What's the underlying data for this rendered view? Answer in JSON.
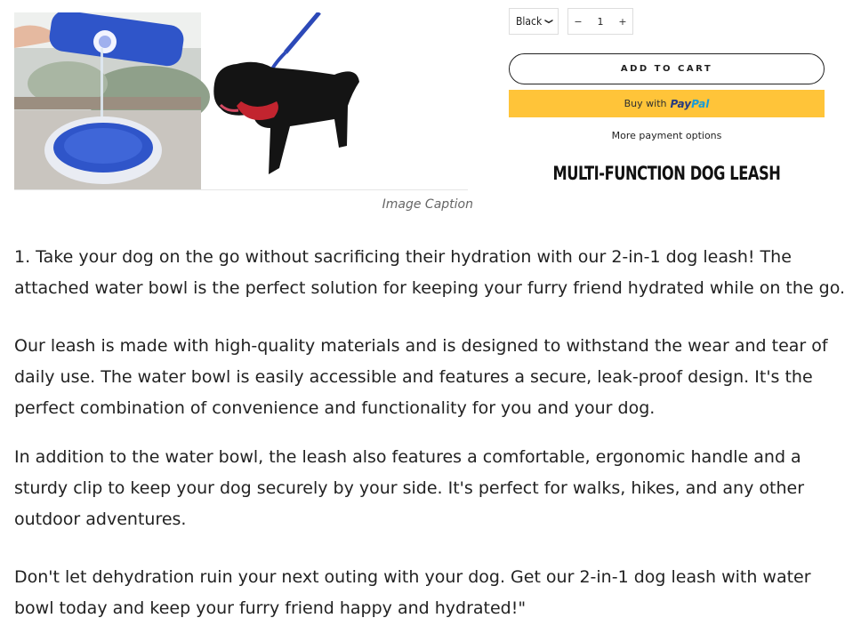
{
  "image": {
    "caption": "Image Caption"
  },
  "product": {
    "variant_selected": "Black",
    "quantity": "1",
    "decrement_label": "−",
    "increment_label": "+",
    "add_to_cart_label": "ADD TO CART",
    "paypal_prefix": "Buy with",
    "paypal_logo_pay": "Pay",
    "paypal_logo_pal": "Pal",
    "more_payment_label": "More payment options",
    "title": "MULTI-FUNCTION DOG LEASH"
  },
  "description": {
    "paragraphs": [
      "1. Take your dog on the go without sacrificing their hydration with our 2-in-1 dog leash! The attached water bowl is the perfect solution for keeping your furry friend hydrated while on the go.",
      "Our leash is made with high-quality materials and is designed to withstand the wear and tear of daily use. The water bowl is easily accessible and features a secure, leak-proof design. It's the perfect combination of convenience and functionality for you and your dog.",
      "In addition to the water bowl, the leash also features a comfortable, ergonomic handle and a sturdy clip to keep your dog securely by your side. It's perfect for walks, hikes, and any other outdoor adventures.",
      "Don't let dehydration ruin your next outing with your dog. Get our 2-in-1 dog leash with water bowl today and keep your furry friend happy and hydrated!\""
    ]
  },
  "colors": {
    "paypal_button": "#ffc439",
    "paypal_blue_dark": "#253b80",
    "paypal_blue_light": "#179bd7",
    "bowl_blue": "#2f55c9"
  },
  "icons": {
    "variant_dropdown": "chevron-down-icon"
  }
}
